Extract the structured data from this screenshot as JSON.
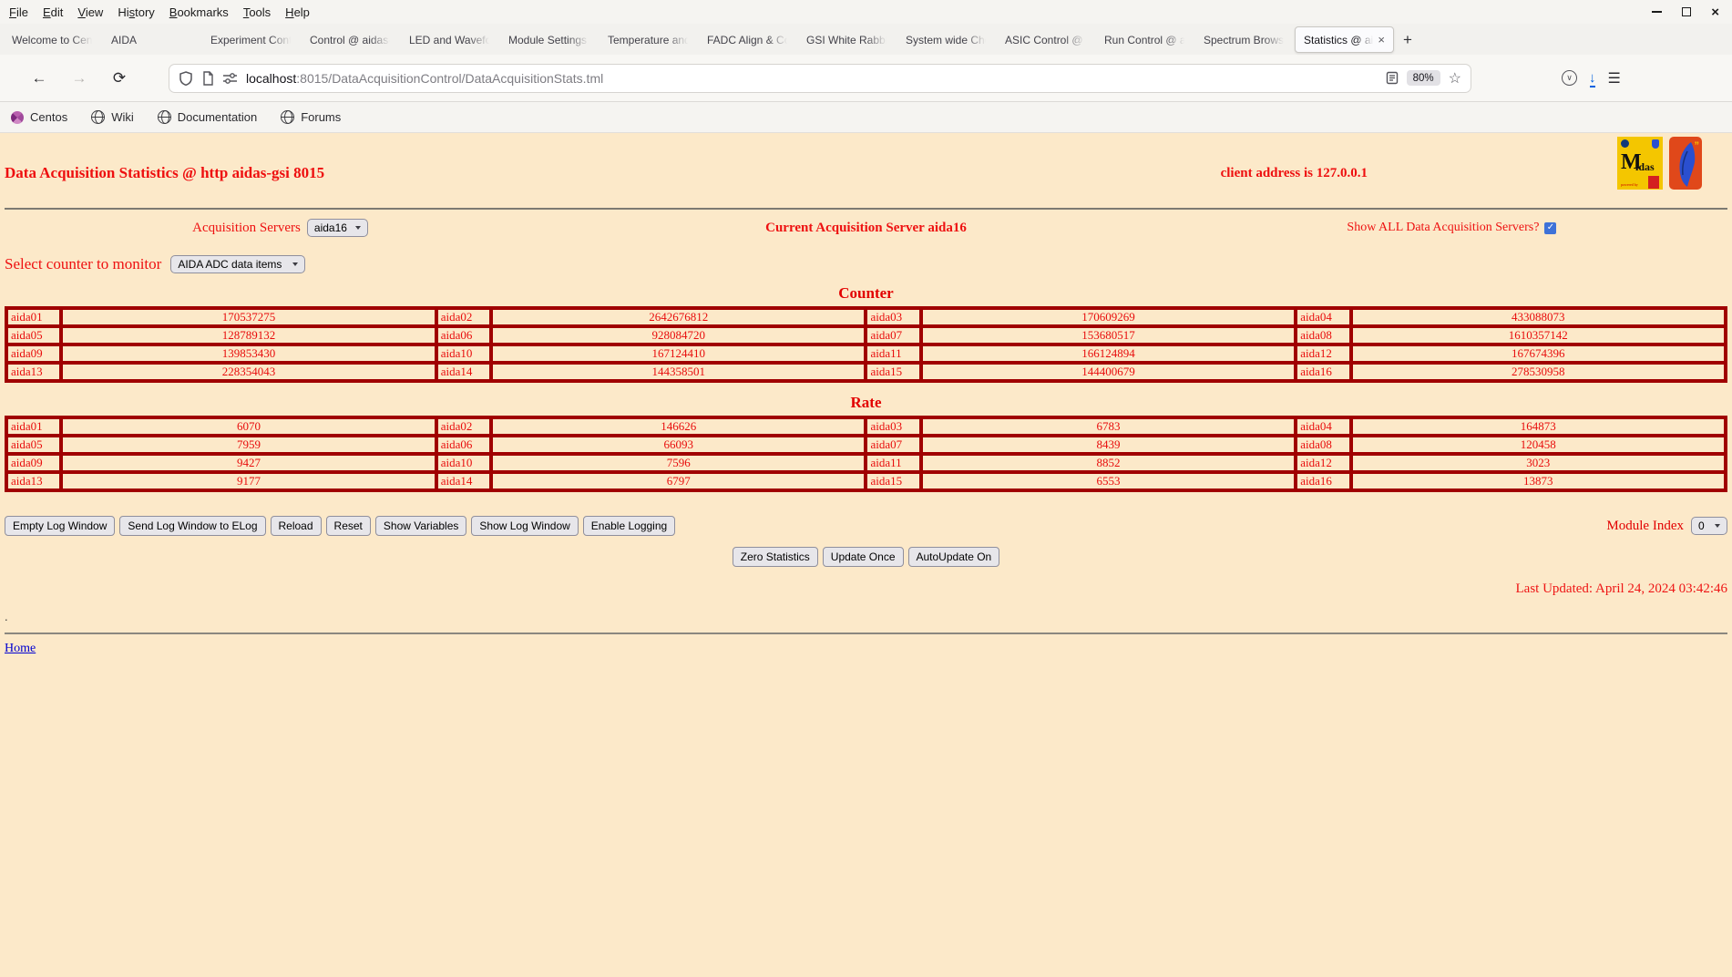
{
  "menubar": {
    "items": [
      {
        "pre": "",
        "key": "F",
        "post": "ile"
      },
      {
        "pre": "",
        "key": "E",
        "post": "dit"
      },
      {
        "pre": "",
        "key": "V",
        "post": "iew"
      },
      {
        "pre": "Hi",
        "key": "s",
        "post": "tory"
      },
      {
        "pre": "",
        "key": "B",
        "post": "ookmarks"
      },
      {
        "pre": "",
        "key": "T",
        "post": "ools"
      },
      {
        "pre": "",
        "key": "H",
        "post": "elp"
      }
    ]
  },
  "tabbar": {
    "tabs": [
      {
        "label": "Welcome to Cent",
        "active": false
      },
      {
        "label": "AIDA",
        "active": false
      },
      {
        "label": "Experiment Contr",
        "active": false
      },
      {
        "label": "Control @ aidas-",
        "active": false
      },
      {
        "label": "LED and Wavefor",
        "active": false
      },
      {
        "label": "Module Settings S",
        "active": false
      },
      {
        "label": "Temperature and",
        "active": false
      },
      {
        "label": "FADC Align & Co",
        "active": false
      },
      {
        "label": "GSI White Rabbit",
        "active": false
      },
      {
        "label": "System wide Che",
        "active": false
      },
      {
        "label": "ASIC Control @ a",
        "active": false
      },
      {
        "label": "Run Control @ ai",
        "active": false
      },
      {
        "label": "Spectrum Browse",
        "active": false
      },
      {
        "label": "Statistics @ aid",
        "active": true
      }
    ],
    "new_tab": "+",
    "close_glyph": "×"
  },
  "navbar": {
    "url_host": "localhost",
    "url_rest": ":8015/DataAcquisitionControl/DataAcquisitionStats.tml",
    "zoom_level": "80%"
  },
  "bookmarksbar": {
    "items": [
      {
        "label": "Centos",
        "icon": "centos-icon"
      },
      {
        "label": "Wiki",
        "icon": "globe-icon"
      },
      {
        "label": "Documentation",
        "icon": "globe-icon"
      },
      {
        "label": "Forums",
        "icon": "globe-icon"
      }
    ]
  },
  "page": {
    "title": "Data Acquisition Statistics @ http aidas-gsi 8015",
    "client_address": "client address is 127.0.0.1",
    "acquisition_servers_label": "Acquisition Servers",
    "acquisition_server_selected": "aida16",
    "current_server_text": "Current Acquisition Server aida16",
    "show_all_label": "Show ALL Data Acquisition Servers?",
    "show_all_checked": "✓",
    "select_counter_label": "Select counter to monitor",
    "counter_monitor_selected": "AIDA ADC data items",
    "counter_heading": "Counter",
    "rate_heading": "Rate",
    "counter_rows": [
      [
        {
          "n": "aida01",
          "v": "170537275"
        },
        {
          "n": "aida02",
          "v": "2642676812"
        },
        {
          "n": "aida03",
          "v": "170609269"
        },
        {
          "n": "aida04",
          "v": "433088073"
        }
      ],
      [
        {
          "n": "aida05",
          "v": "128789132"
        },
        {
          "n": "aida06",
          "v": "928084720"
        },
        {
          "n": "aida07",
          "v": "153680517"
        },
        {
          "n": "aida08",
          "v": "1610357142"
        }
      ],
      [
        {
          "n": "aida09",
          "v": "139853430"
        },
        {
          "n": "aida10",
          "v": "167124410"
        },
        {
          "n": "aida11",
          "v": "166124894"
        },
        {
          "n": "aida12",
          "v": "167674396"
        }
      ],
      [
        {
          "n": "aida13",
          "v": "228354043"
        },
        {
          "n": "aida14",
          "v": "144358501"
        },
        {
          "n": "aida15",
          "v": "144400679"
        },
        {
          "n": "aida16",
          "v": "278530958"
        }
      ]
    ],
    "rate_rows": [
      [
        {
          "n": "aida01",
          "v": "6070"
        },
        {
          "n": "aida02",
          "v": "146626"
        },
        {
          "n": "aida03",
          "v": "6783"
        },
        {
          "n": "aida04",
          "v": "164873"
        }
      ],
      [
        {
          "n": "aida05",
          "v": "7959"
        },
        {
          "n": "aida06",
          "v": "66093"
        },
        {
          "n": "aida07",
          "v": "8439"
        },
        {
          "n": "aida08",
          "v": "120458"
        }
      ],
      [
        {
          "n": "aida09",
          "v": "9427"
        },
        {
          "n": "aida10",
          "v": "7596"
        },
        {
          "n": "aida11",
          "v": "8852"
        },
        {
          "n": "aida12",
          "v": "3023"
        }
      ],
      [
        {
          "n": "aida13",
          "v": "9177"
        },
        {
          "n": "aida14",
          "v": "6797"
        },
        {
          "n": "aida15",
          "v": "6553"
        },
        {
          "n": "aida16",
          "v": "13873"
        }
      ]
    ],
    "log_buttons": [
      "Empty Log Window",
      "Send Log Window to ELog",
      "Reload",
      "Reset",
      "Show Variables",
      "Show Log Window",
      "Enable Logging"
    ],
    "module_index_label": "Module Index",
    "module_index_selected": "0",
    "update_buttons": [
      "Zero Statistics",
      "Update Once",
      "AutoUpdate On"
    ],
    "last_updated": "Last Updated: April 24, 2024 03:42:46",
    "dot": ".",
    "home_label": "Home",
    "logos": {
      "midas_m": "M",
      "midas_idas": "idas",
      "midas_powered": "powered by",
      "tcl_quotes": "”"
    }
  },
  "colors": {
    "page_bg": "#fce9c9",
    "red_text": "#ee1111",
    "table_border": "#a00000",
    "link_blue": "#0000d0",
    "download_blue": "#0061e0"
  }
}
